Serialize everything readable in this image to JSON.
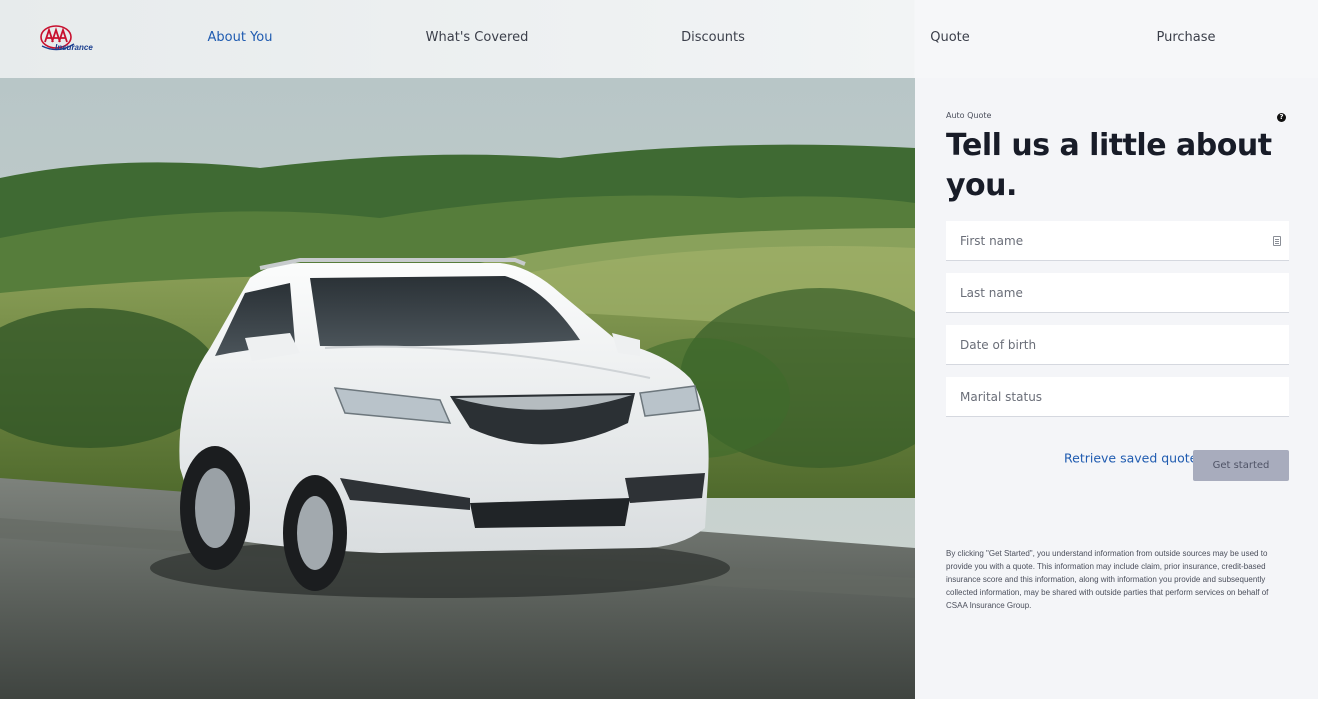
{
  "brand": {
    "logo_letters": "AAA",
    "logo_subtitle": "Insurance",
    "logo_red": "#c8102e",
    "logo_blue": "#1b3f8f"
  },
  "nav": {
    "items": [
      {
        "label": "About You",
        "active": true
      },
      {
        "label": "What's Covered",
        "active": false
      },
      {
        "label": "Discounts",
        "active": false
      },
      {
        "label": "Quote",
        "active": false
      },
      {
        "label": "Purchase",
        "active": false
      }
    ],
    "active_color": "#1f5bb0"
  },
  "hero": {
    "subject": "white SUV driving on a road through green hills"
  },
  "form": {
    "eyebrow": "Auto Quote",
    "help_icon": "?",
    "headline": "Tell us a little about you.",
    "fields": {
      "first_name": {
        "placeholder": "First name",
        "value": ""
      },
      "last_name": {
        "placeholder": "Last name",
        "value": ""
      },
      "dob": {
        "placeholder": "Date of birth",
        "value": ""
      },
      "marital": {
        "placeholder": "Marital status",
        "value": ""
      }
    },
    "retrieve_label": "Retrieve saved quote",
    "submit_label": "Get started",
    "disclaimer": "By clicking \"Get Started\", you understand information from outside sources may be used to provide you with a quote. This information may include claim, prior insurance, credit-based insurance score and this information, along with information you provide and subsequently collected information, may be shared with outside parties that perform services on behalf of CSAA Insurance Group."
  },
  "colors": {
    "accent": "#1f5bb0",
    "button_disabled": "#a8acbd",
    "panel_bg": "#f4f5f8"
  }
}
